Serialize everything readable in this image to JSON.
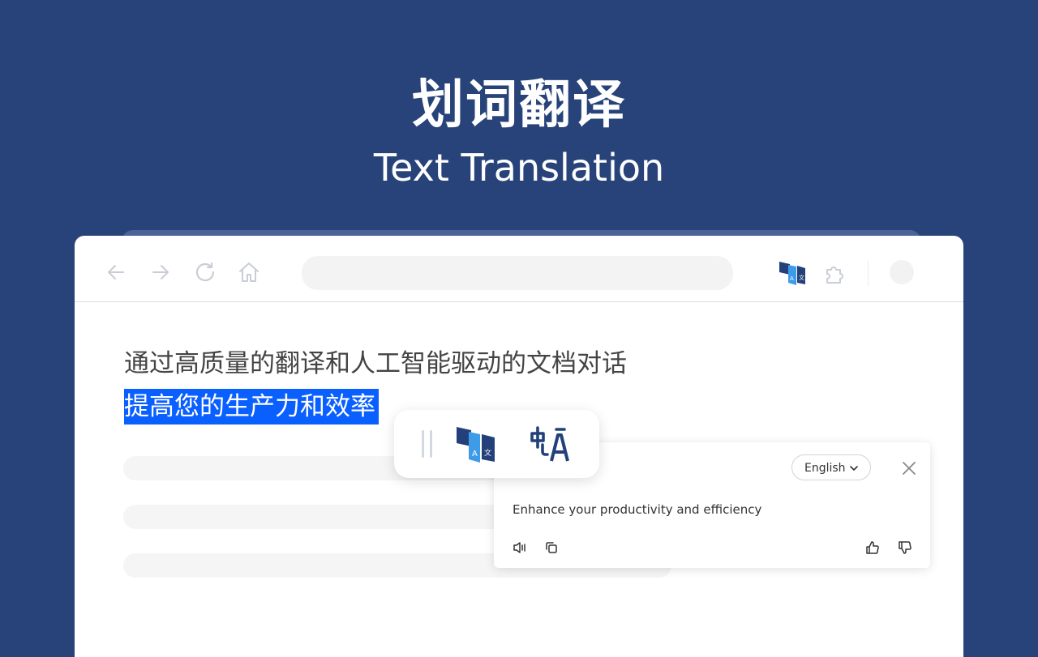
{
  "hero": {
    "title": "划词翻译",
    "subtitle": "Text Translation"
  },
  "browser": {
    "toolbar": {
      "icons": [
        "back-arrow-icon",
        "forward-arrow-icon",
        "reload-icon",
        "home-icon",
        "extension-logo-icon",
        "puzzle-icon"
      ]
    },
    "content": {
      "line1": "通过高质量的翻译和人工智能驱动的文档对话",
      "line2_selected": "提高您的生产力和效率"
    }
  },
  "float_toolbar": {
    "icons": [
      "drag-handle-icon",
      "translate-logo-icon",
      "language-switch-icon"
    ]
  },
  "result_panel": {
    "language": "English",
    "translation": "Enhance your productivity and efficiency",
    "icons": [
      "speaker-icon",
      "copy-icon",
      "thumbs-up-icon",
      "thumbs-down-icon",
      "close-icon"
    ]
  },
  "colors": {
    "background": "#28437a",
    "selection": "#0a5fff",
    "brand_dark": "#24407a",
    "brand_light": "#3d9be9"
  }
}
